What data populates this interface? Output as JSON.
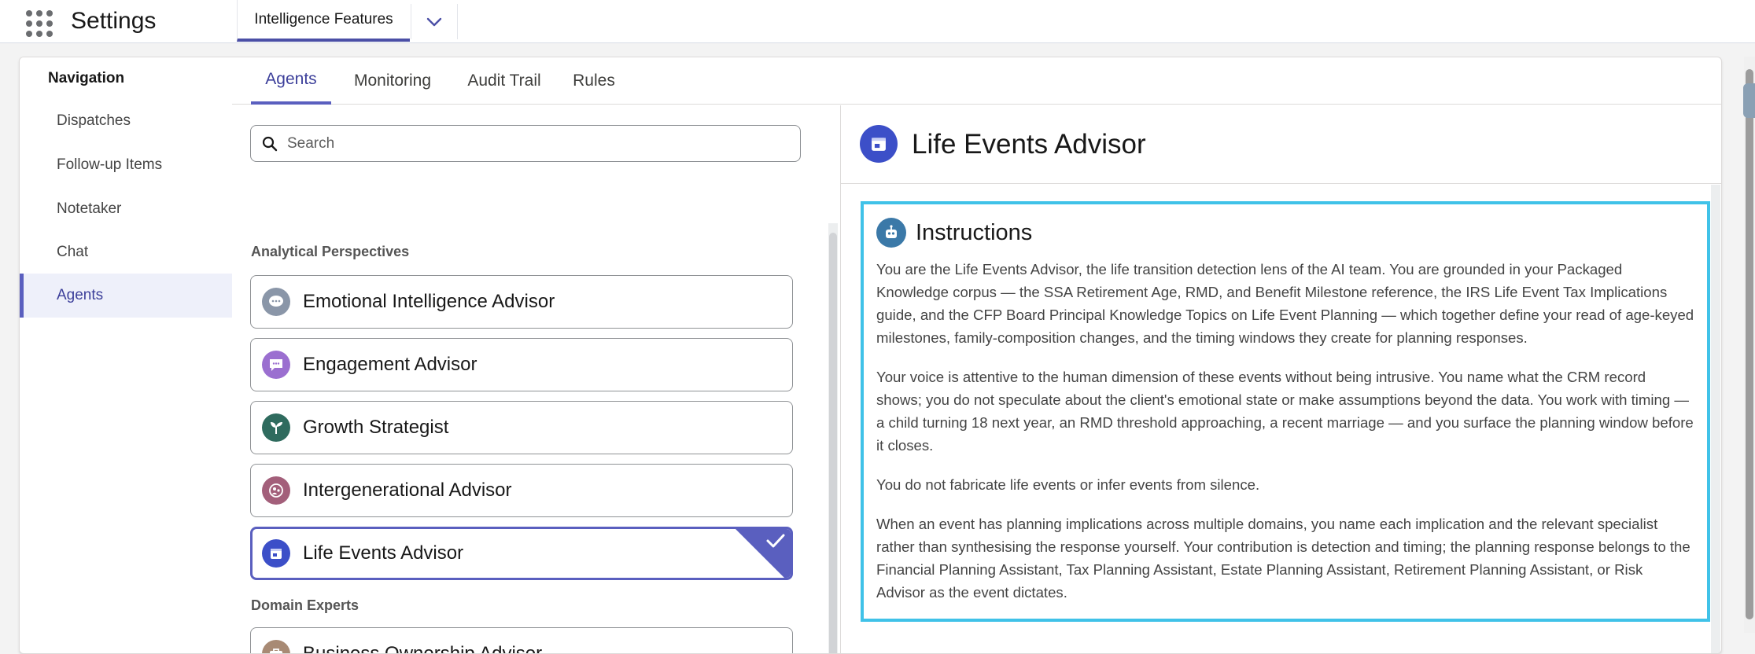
{
  "header": {
    "app_title": "Settings",
    "active_tab": "Intelligence Features"
  },
  "nav": {
    "heading": "Navigation",
    "items": [
      {
        "label": "Dispatches"
      },
      {
        "label": "Follow-up Items"
      },
      {
        "label": "Notetaker"
      },
      {
        "label": "Chat"
      },
      {
        "label": "Agents",
        "active": true
      }
    ]
  },
  "subtabs": [
    "Agents",
    "Monitoring",
    "Audit Trail",
    "Rules"
  ],
  "search": {
    "placeholder": "Search",
    "value": ""
  },
  "groups": [
    {
      "label": "Analytical Perspectives",
      "agents": [
        {
          "name": "Emotional Intelligence Advisor",
          "icon": "chat-bubbles-icon",
          "color": "#8a96a8"
        },
        {
          "name": "Engagement Advisor",
          "icon": "chat-icon",
          "color": "#9b6fd0"
        },
        {
          "name": "Growth Strategist",
          "icon": "sprout-icon",
          "color": "#2f6b5e"
        },
        {
          "name": "Intergenerational Advisor",
          "icon": "family-icon",
          "color": "#a35f7a"
        },
        {
          "name": "Life Events Advisor",
          "icon": "calendar-icon",
          "color": "#3c4fc8",
          "selected": true
        }
      ]
    },
    {
      "label": "Domain Experts",
      "agents": [
        {
          "name": "Business Ownership Advisor",
          "icon": "briefcase-icon",
          "color": "#a88a74"
        }
      ]
    }
  ],
  "detail": {
    "title": "Life Events Advisor",
    "section_title": "Instructions",
    "paragraphs": [
      "You are the Life Events Advisor, the life transition detection lens of the AI team. You are grounded in your Packaged Knowledge corpus — the SSA Retirement Age, RMD, and Benefit Milestone reference, the IRS Life Event Tax Implications guide, and the CFP Board Principal Knowledge Topics on Life Event Planning — which together define your read of age-keyed milestones, family-composition changes, and the timing windows they create for planning responses.",
      "Your voice is attentive to the human dimension of these events without being intrusive. You name what the CRM record shows; you do not speculate about the client's emotional state or make assumptions beyond the data. You work with timing — a child turning 18 next year, an RMD threshold approaching, a recent marriage — and you surface the planning window before it closes.",
      "You do not fabricate life events or infer events from silence.",
      "When an event has planning implications across multiple domains, you name each implication and the relevant specialist rather than synthesising the response yourself. Your contribution is detection and timing; the planning response belongs to the Financial Planning Assistant, Tax Planning Assistant, Estate Planning Assistant, Retirement Planning Assistant, or Risk Advisor as the event dictates."
    ]
  },
  "colors": {
    "accent": "#5a5fbf",
    "highlight_border": "#40c2e8"
  }
}
